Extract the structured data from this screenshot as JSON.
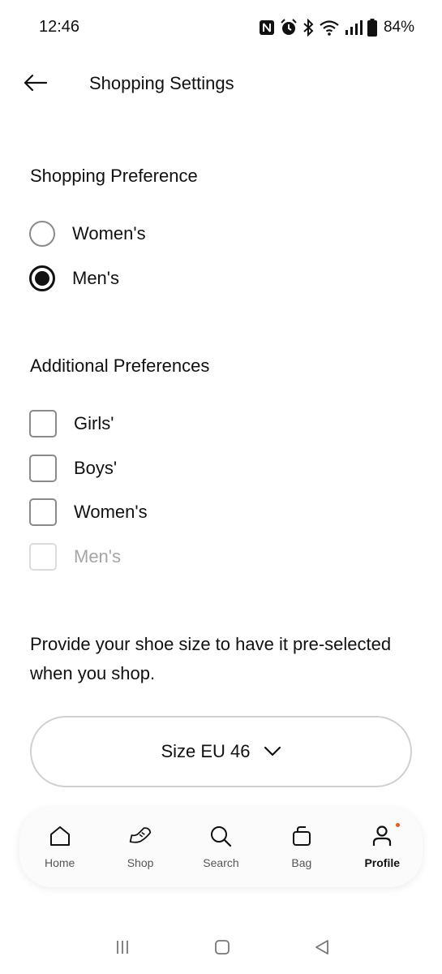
{
  "status_bar": {
    "time": "12:46",
    "battery": "84%",
    "icons": [
      "nfc-icon",
      "alarm-icon",
      "bluetooth-icon",
      "wifi-icon",
      "signal-icon",
      "battery-icon"
    ]
  },
  "header": {
    "title": "Shopping Settings",
    "back_icon": "arrow-left-icon"
  },
  "shopping_preference": {
    "title": "Shopping Preference",
    "options": [
      {
        "label": "Women's",
        "selected": false
      },
      {
        "label": "Men's",
        "selected": true
      }
    ]
  },
  "additional_preferences": {
    "title": "Additional Preferences",
    "options": [
      {
        "label": "Girls'",
        "checked": false,
        "disabled": false
      },
      {
        "label": "Boys'",
        "checked": false,
        "disabled": false
      },
      {
        "label": "Women's",
        "checked": false,
        "disabled": false
      },
      {
        "label": "Men's",
        "checked": false,
        "disabled": true
      }
    ]
  },
  "shoe_size": {
    "hint": "Provide your shoe size to have it pre-selected when you shop.",
    "selected_label": "Size EU 46"
  },
  "bottom_nav": {
    "items": [
      {
        "label": "Home",
        "icon": "home-icon",
        "active": false
      },
      {
        "label": "Shop",
        "icon": "shoe-icon",
        "active": false
      },
      {
        "label": "Search",
        "icon": "search-icon",
        "active": false
      },
      {
        "label": "Bag",
        "icon": "bag-icon",
        "active": false
      },
      {
        "label": "Profile",
        "icon": "profile-icon",
        "active": true
      }
    ],
    "notification_color": "#e85a1e"
  },
  "system_nav": {
    "icons": [
      "recents-icon",
      "home-button-icon",
      "back-triangle-icon"
    ]
  }
}
